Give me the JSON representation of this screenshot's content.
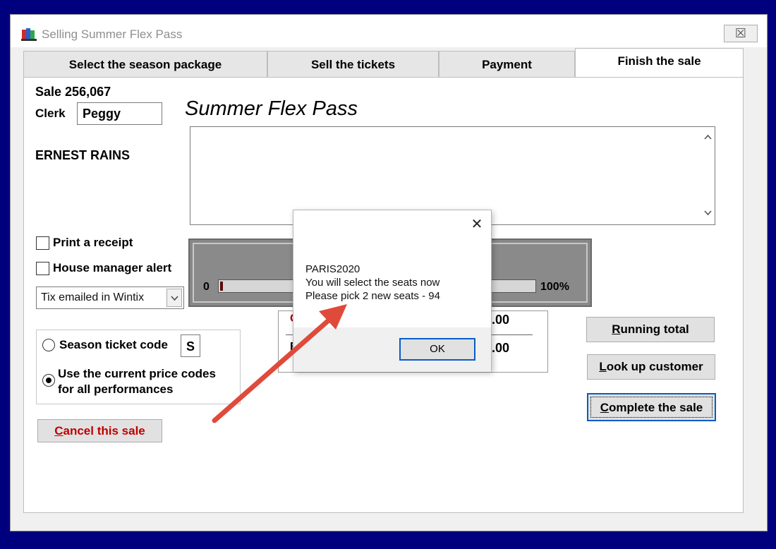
{
  "window": {
    "title": "Selling Summer Flex Pass",
    "close_label": "☒"
  },
  "tabs": [
    {
      "label": "Select the season package",
      "active": false
    },
    {
      "label": "Sell the tickets",
      "active": false
    },
    {
      "label": "Payment",
      "active": false
    },
    {
      "label": "Finish the sale",
      "active": true
    }
  ],
  "sale": {
    "label": "Sale",
    "number": "256,067",
    "clerk_label": "Clerk",
    "clerk_value": "Peggy",
    "customer_name": "ERNEST RAINS",
    "package_title": "Summer Flex Pass"
  },
  "options": {
    "print_receipt": {
      "label": "Print a receipt",
      "checked": false
    },
    "house_manager": {
      "label": "House manager alert",
      "checked": false
    },
    "delivery_select": {
      "value": "Tix emailed in Wintix"
    }
  },
  "price_group": {
    "season_code_label": "Season ticket code",
    "season_code_value": "S",
    "season_code_selected": false,
    "current_prices_label_1": "Use the current price codes",
    "current_prices_label_2": "for all performances",
    "current_prices_selected": true
  },
  "totals": {
    "value_1": "0.00",
    "value_2": "0.00"
  },
  "progress": {
    "start_label": "0",
    "end_label": "100%",
    "fraction": 0.01
  },
  "buttons": {
    "cancel_pre": "",
    "cancel_acc": "C",
    "cancel_post": "ancel this sale",
    "running_acc": "R",
    "running_post": "unning total",
    "lookup_acc": "L",
    "lookup_post": "ook up customer",
    "complete_acc": "C",
    "complete_post": "omplete the sale"
  },
  "dialog": {
    "line1": "PARIS2020",
    "line2": "You will select the seats now",
    "line3": "Please pick 2 new seats - 94",
    "ok_label": "OK",
    "close_label": "✕"
  },
  "colors": {
    "background": "#00007f",
    "cancel_text": "#c00000",
    "arrow": "#e04a3a",
    "focus_border": "#0a5cc5"
  }
}
